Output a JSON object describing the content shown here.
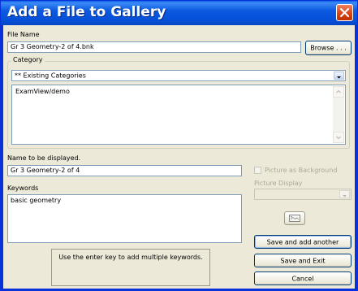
{
  "window": {
    "title": "Add a File to Gallery"
  },
  "file_name": {
    "label": "File Name",
    "value": "Gr 3 Geometry-2 of 4.bnk",
    "browse_label": "Browse . . ."
  },
  "category": {
    "group_label": "Category",
    "selected": "** Existing Categories",
    "items": [
      "ExamView/demo"
    ]
  },
  "display_name": {
    "label": "Name to be displayed.",
    "value": "Gr 3 Geometry-2 of 4"
  },
  "picture": {
    "checkbox_label": "Picture as Background",
    "display_label": "Picture Display",
    "display_value": ""
  },
  "keywords": {
    "label": "Keywords",
    "value": "basic geometry",
    "hint": "Use the enter key to add multiple keywords."
  },
  "buttons": {
    "save_add": "Save and add another",
    "save_exit": "Save and Exit",
    "cancel": "Cancel"
  },
  "icons": {
    "close": "close-icon",
    "dropdown": "chevron-down-icon",
    "picture": "picture-icon"
  }
}
